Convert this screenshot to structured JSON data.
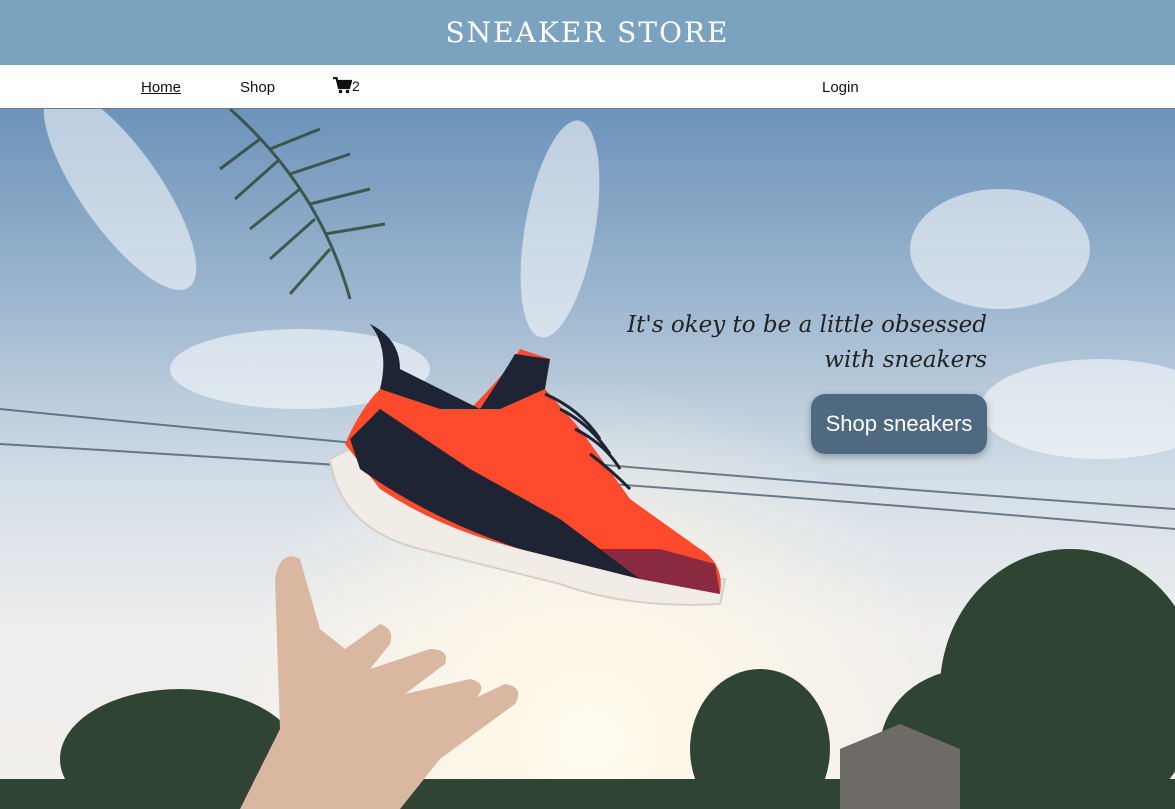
{
  "brand": "SNEAKER STORE",
  "nav": {
    "home": "Home",
    "shop": "Shop",
    "cart_count": "2",
    "login": "Login"
  },
  "hero": {
    "tagline_line1": "It's okey to be a little obsessed",
    "tagline_line2": "with sneakers",
    "cta_label": "Shop sneakers"
  },
  "colors": {
    "banner": "#7ba3c0",
    "cta": "#4e6980",
    "shoe_primary": "#ff4a2e",
    "shoe_dark": "#1e2433"
  },
  "icons": [
    "cart-icon"
  ]
}
